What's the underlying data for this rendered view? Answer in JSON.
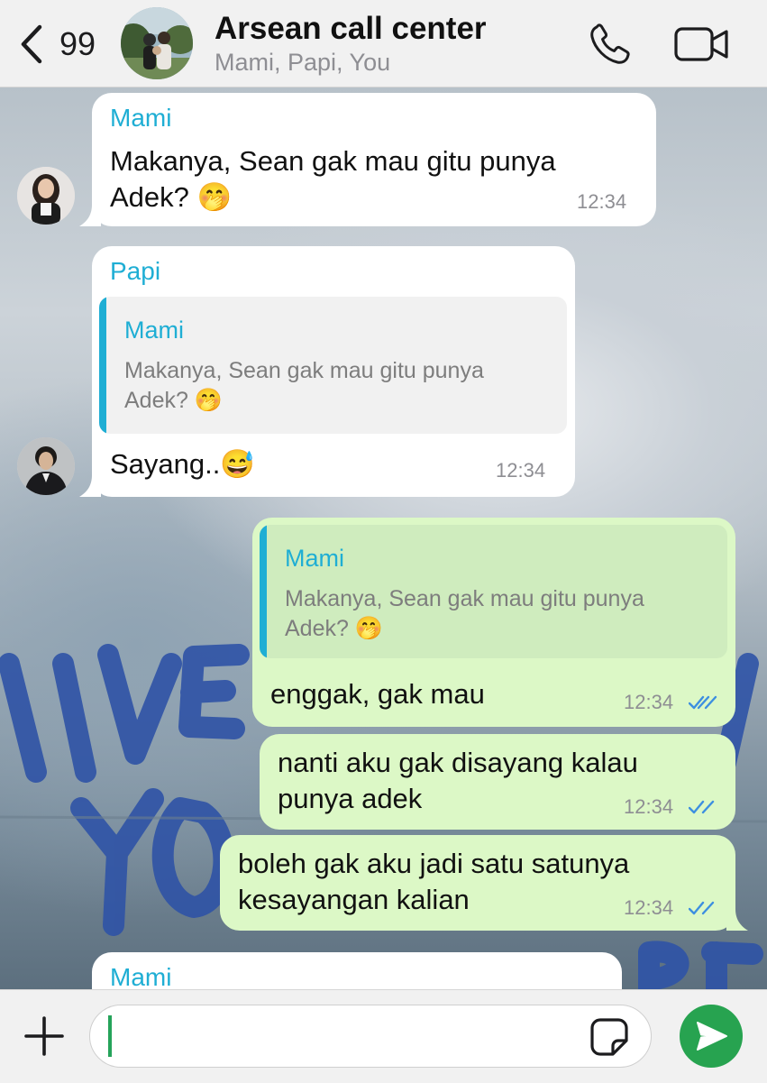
{
  "header": {
    "back_count": "99",
    "title": "Arsean call center",
    "subtitle": "Mami, Papi, You"
  },
  "messages": [
    {
      "direction": "incoming",
      "sender": "Mami",
      "text_lines": [
        "Makanya, Sean gak mau gitu punya",
        "Adek? 🤭"
      ],
      "time": "12:34"
    },
    {
      "direction": "incoming",
      "sender": "Papi",
      "quote": {
        "sender": "Mami",
        "text_lines": [
          "Makanya, Sean gak mau gitu punya",
          "Adek? 🤭"
        ]
      },
      "text": "Sayang..😅",
      "time": "12:34"
    },
    {
      "direction": "outgoing",
      "quote": {
        "sender": "Mami",
        "text_lines": [
          "Makanya, Sean gak mau gitu punya",
          "Adek? 🤭"
        ]
      },
      "text": "enggak, gak mau",
      "time": "12:34",
      "status": "read"
    },
    {
      "direction": "outgoing",
      "text_lines": [
        "nanti aku gak disayang kalau",
        "punya adek"
      ],
      "time": "12:34",
      "status": "read"
    },
    {
      "direction": "outgoing",
      "text_lines": [
        "boleh gak aku jadi satu satunya",
        "kesayangan kalian"
      ],
      "time": "12:34",
      "status": "read"
    },
    {
      "direction": "incoming",
      "sender": "Mami"
    }
  ],
  "composer": {
    "input_value": ""
  },
  "colors": {
    "sender_name": "#1faed4",
    "outgoing_bubble": "#dcf8c6",
    "read_ticks": "#3d8fe0",
    "send_button": "#27a350"
  },
  "icons": [
    "back-chevron-icon",
    "phone-icon",
    "video-camera-icon",
    "plus-icon",
    "sticker-icon",
    "send-icon"
  ]
}
